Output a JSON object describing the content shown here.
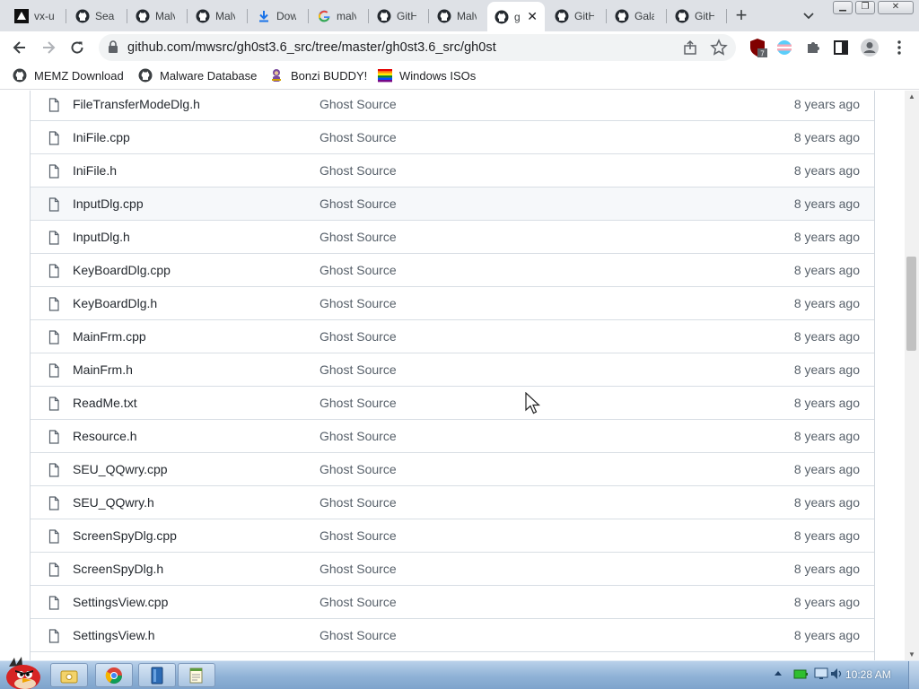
{
  "browser": {
    "tabs": [
      {
        "label": "vx-u",
        "icon": "vx-underground-icon"
      },
      {
        "label": "Sear",
        "icon": "github-icon"
      },
      {
        "label": "Malv",
        "icon": "github-icon"
      },
      {
        "label": "Malv",
        "icon": "github-icon"
      },
      {
        "label": "Dow",
        "icon": "download-icon"
      },
      {
        "label": "malv",
        "icon": "google-icon"
      },
      {
        "label": "GitH",
        "icon": "github-icon"
      },
      {
        "label": "Malv",
        "icon": "github-icon"
      },
      {
        "label": "g",
        "icon": "github-icon",
        "active": true
      },
      {
        "label": "GitH",
        "icon": "github-icon"
      },
      {
        "label": "Gala",
        "icon": "github-icon"
      },
      {
        "label": "GitH",
        "icon": "github-icon"
      }
    ],
    "url": "github.com/mwsrc/gh0st3.6_src/tree/master/gh0st3.6_src/gh0st",
    "extension_badge": "7",
    "bookmarks": [
      {
        "label": "MEMZ Download",
        "icon": "github-icon"
      },
      {
        "label": "Malware Database",
        "icon": "github-icon"
      },
      {
        "label": "Bonzi BUDDY!",
        "icon": "bonzi-icon"
      },
      {
        "label": "Windows ISOs",
        "icon": "rainbow-flag-icon"
      }
    ]
  },
  "file_list": [
    {
      "name": "FileTransferModeDlg.h",
      "commit": "Ghost Source",
      "age": "8 years ago"
    },
    {
      "name": "IniFile.cpp",
      "commit": "Ghost Source",
      "age": "8 years ago"
    },
    {
      "name": "IniFile.h",
      "commit": "Ghost Source",
      "age": "8 years ago"
    },
    {
      "name": "InputDlg.cpp",
      "commit": "Ghost Source",
      "age": "8 years ago"
    },
    {
      "name": "InputDlg.h",
      "commit": "Ghost Source",
      "age": "8 years ago"
    },
    {
      "name": "KeyBoardDlg.cpp",
      "commit": "Ghost Source",
      "age": "8 years ago"
    },
    {
      "name": "KeyBoardDlg.h",
      "commit": "Ghost Source",
      "age": "8 years ago"
    },
    {
      "name": "MainFrm.cpp",
      "commit": "Ghost Source",
      "age": "8 years ago"
    },
    {
      "name": "MainFrm.h",
      "commit": "Ghost Source",
      "age": "8 years ago"
    },
    {
      "name": "ReadMe.txt",
      "commit": "Ghost Source",
      "age": "8 years ago"
    },
    {
      "name": "Resource.h",
      "commit": "Ghost Source",
      "age": "8 years ago"
    },
    {
      "name": "SEU_QQwry.cpp",
      "commit": "Ghost Source",
      "age": "8 years ago"
    },
    {
      "name": "SEU_QQwry.h",
      "commit": "Ghost Source",
      "age": "8 years ago"
    },
    {
      "name": "ScreenSpyDlg.cpp",
      "commit": "Ghost Source",
      "age": "8 years ago"
    },
    {
      "name": "ScreenSpyDlg.h",
      "commit": "Ghost Source",
      "age": "8 years ago"
    },
    {
      "name": "SettingsView.cpp",
      "commit": "Ghost Source",
      "age": "8 years ago"
    },
    {
      "name": "SettingsView.h",
      "commit": "Ghost Source",
      "age": "8 years ago"
    },
    {
      "name": "",
      "commit": "",
      "age": ""
    }
  ],
  "taskbar": {
    "clock": "10:28 AM",
    "apps": [
      "explorer-icon",
      "chrome-icon",
      "notebook-icon",
      "notepad-icon"
    ]
  },
  "colors": {
    "link_text": "#24292f",
    "muted_text": "#57606a",
    "border": "#d0d7de",
    "tabstrip": "#dee1e6"
  }
}
